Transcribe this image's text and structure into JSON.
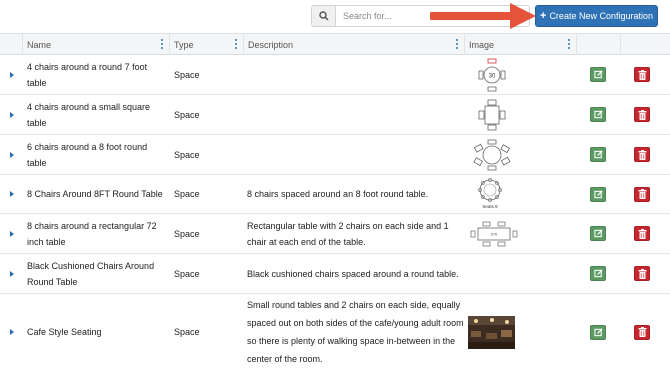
{
  "toolbar": {
    "search_placeholder": "Search for...",
    "search_value": "",
    "create_label": "Create New Configuration",
    "create_icon": "plus-icon"
  },
  "table": {
    "columns": [
      "Name",
      "Type",
      "Description",
      "Image"
    ],
    "rows": [
      {
        "name": "4 chairs around a round 7 foot table",
        "type": "Space",
        "description": "",
        "image": "round-table-4-chairs"
      },
      {
        "name": "4 chairs around a small square table",
        "type": "Space",
        "description": "",
        "image": "square-table-4-chairs"
      },
      {
        "name": "6 chairs around a 8 foot round table",
        "type": "Space",
        "description": "",
        "image": "round-table-6-chairs"
      },
      {
        "name": "8 Chairs Around 8FT Round Table",
        "type": "Space",
        "description": "8 chairs spaced around an 8 foot round table.",
        "image": "round-table-8-chairs",
        "image_caption": "Seats 8"
      },
      {
        "name": "8 chairs around a rectangular 72 inch table",
        "type": "Space",
        "description": "Rectangular table with 2 chairs on each side and 1 chair at each end of the table.",
        "image": "rectangular-table-6-chairs",
        "image_caption": "6 ft"
      },
      {
        "name": "Black Cushioned Chairs Around Round Table",
        "type": "Space",
        "description": "Black cushioned chairs spaced around a round table.",
        "image": ""
      },
      {
        "name": "Cafe Style Seating",
        "type": "Space",
        "description": "Small round tables and 2 chairs on each side, equally spaced out on both sides of the cafe/young adult room so there is plenty of walking space in-between in the center of the room.",
        "image": "cafe-photo"
      }
    ]
  },
  "image_labels": {
    "round7": "30"
  },
  "colors": {
    "primary": "#2f73b6",
    "edit": "#5b9a63",
    "delete": "#c6262e",
    "annotation_arrow": "#e4533a"
  }
}
